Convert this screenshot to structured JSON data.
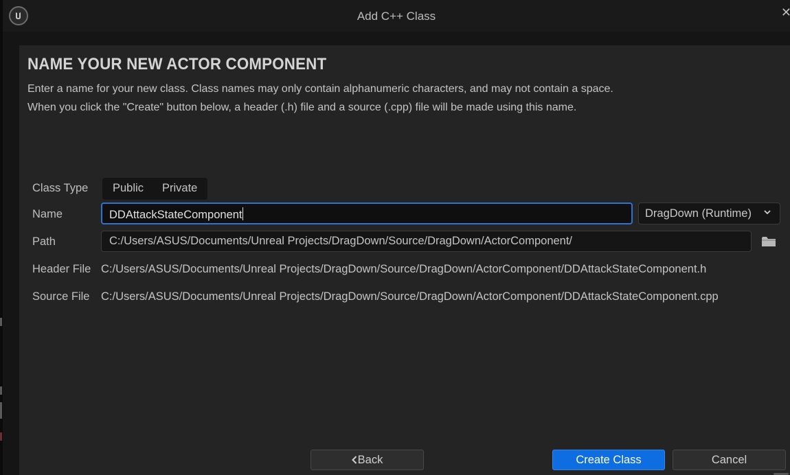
{
  "window": {
    "title": "Add C++ Class",
    "close_glyph": "✕"
  },
  "page": {
    "heading": "NAME YOUR NEW ACTOR COMPONENT",
    "description_line1": "Enter a name for your new class. Class names may only contain alphanumeric characters, and may not contain a space.",
    "description_line2": "When you click the \"Create\" button below, a header (.h) file and a source (.cpp) file will be made using this name."
  },
  "form": {
    "class_type_label": "Class Type",
    "class_type_options": [
      "Public",
      "Private"
    ],
    "name_label": "Name",
    "name_value": "DDAttackStateComponent",
    "module_value": "DragDown (Runtime)",
    "path_label": "Path",
    "path_value": "C:/Users/ASUS/Documents/Unreal Projects/DragDown/Source/DragDown/ActorComponent/",
    "header_label": "Header File",
    "header_value": "C:/Users/ASUS/Documents/Unreal Projects/DragDown/Source/DragDown/ActorComponent/DDAttackStateComponent.h",
    "source_label": "Source File",
    "source_value": "C:/Users/ASUS/Documents/Unreal Projects/DragDown/Source/DragDown/ActorComponent/DDAttackStateComponent.cpp"
  },
  "buttons": {
    "back": "Back",
    "create": "Create Class",
    "cancel": "Cancel"
  },
  "colors": {
    "accent": "#0e6de0",
    "focus_border": "#2f73d0",
    "panel": "#242424",
    "titlebar": "#1a1a1a"
  },
  "icons": {
    "logo": "unreal-engine-logo",
    "module_dropdown": "chevron-down-icon",
    "browse": "folder-icon",
    "back": "chevron-left-icon",
    "close": "close-icon"
  }
}
